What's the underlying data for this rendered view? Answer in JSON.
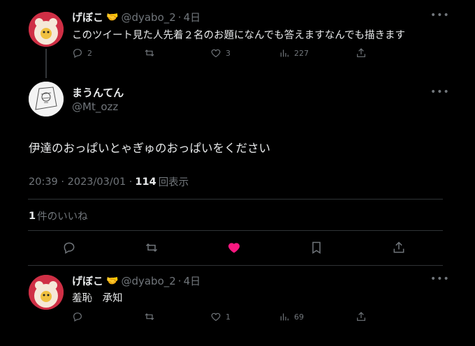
{
  "colors": {
    "background": "#000000",
    "text": "#e7e9ea",
    "secondary": "#71767b",
    "like": "#f91880",
    "avatar_red": "#cf2f45"
  },
  "tweet1": {
    "name": "げぼこ",
    "name_emoji": "🤝",
    "handle": "@dyabo_2",
    "time": "4日",
    "text": "このツイート見た人先着２名のお題になんでも答えますなんでも描きます",
    "replies": "2",
    "retweets": "",
    "likes": "3",
    "views": "227"
  },
  "main": {
    "name": "まうんてん",
    "handle": "@Mt_ozz",
    "text": "伊達のおっぱいとゃぎゅのおっぱいをください",
    "timestamp": "20:39 · 2023/03/01 · ",
    "views_count": "114",
    "views_label": "回表示",
    "likes_count": "1",
    "likes_label": "件のいいね"
  },
  "reply": {
    "name": "げぼこ",
    "name_emoji": "🤝",
    "handle": "@dyabo_2",
    "time": "4日",
    "text": "羞恥　承知",
    "replies": "",
    "retweets": "",
    "likes": "1",
    "views": "69"
  },
  "separator_dot": "·",
  "more_glyph": "•••"
}
